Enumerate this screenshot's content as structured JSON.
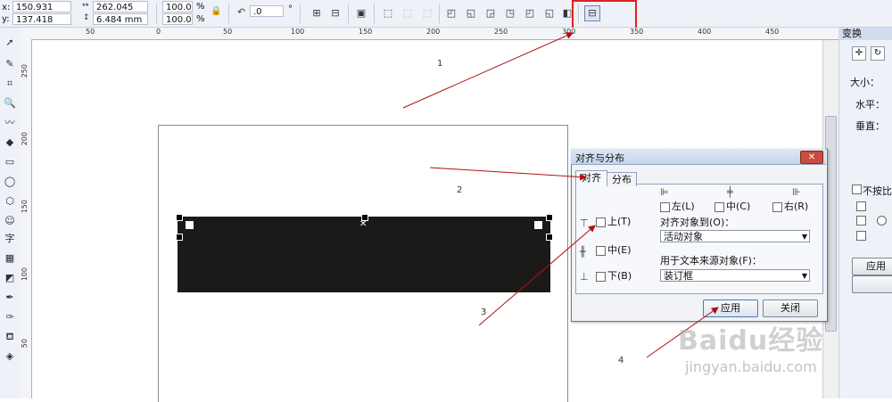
{
  "propbar": {
    "x_label": "x:",
    "x_value": "150.931 mm",
    "y_label": "y:",
    "y_value": "137.418 mm",
    "w_value": "262.045 mm",
    "h_value": "6.484 mm",
    "scale_x": "100.0",
    "scale_y": "100.0",
    "percent": "%",
    "rotation": ".0",
    "degree": "°"
  },
  "hruler": [
    "50",
    "0",
    "50",
    "100",
    "150",
    "200",
    "250",
    "300",
    "350",
    "400",
    "450"
  ],
  "vruler": [
    "250",
    "200",
    "150",
    "100",
    "50"
  ],
  "docker": {
    "title": "变换",
    "size_label": "大小：",
    "h_label": "水平：",
    "v_label": "垂直：",
    "proportional": "不按比例",
    "apply": "应用"
  },
  "dialog": {
    "title": "对齐与分布",
    "close": "✕",
    "tab_align": "对齐",
    "tab_distribute": "分布",
    "left": "左(L)",
    "center": "中(C)",
    "right": "右(R)",
    "top": "上(T)",
    "middle": "中(E)",
    "bottom": "下(B)",
    "align_to_label": "对齐对象到(O)：",
    "align_to_value": "活动对象",
    "text_source_label": "用于文本来源对象(F)：",
    "text_source_value": "装订框",
    "apply": "应用",
    "close_button": "关闭"
  },
  "annotations": [
    "1",
    "2",
    "3",
    "4"
  ],
  "watermark": {
    "text": "Baidu经验",
    "url": "jingyan.baidu.com"
  },
  "colors": {
    "arrow": "#b01010",
    "highlight": "#e02020"
  }
}
